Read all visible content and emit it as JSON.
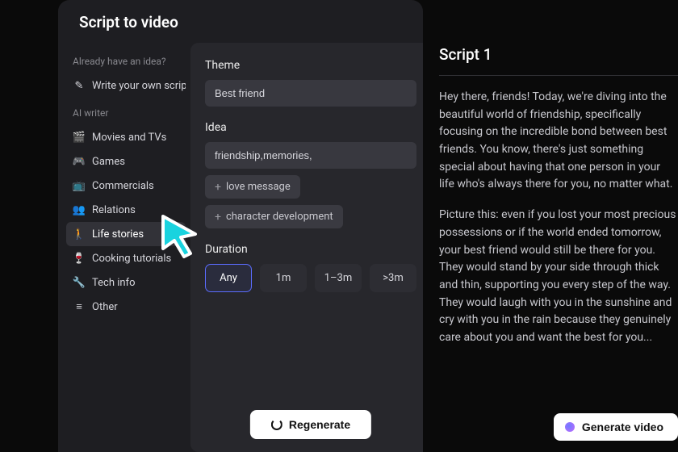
{
  "panelTitle": "Script to video",
  "sidebar": {
    "heading1": "Already have an idea?",
    "writeOwn": "Write your own script",
    "heading2": "AI writer",
    "items": [
      {
        "icon": "🎬",
        "label": "Movies and TVs"
      },
      {
        "icon": "🎮",
        "label": "Games"
      },
      {
        "icon": "📺",
        "label": "Commercials"
      },
      {
        "icon": "👥",
        "label": "Relations"
      },
      {
        "icon": "🚶",
        "label": "Life stories"
      },
      {
        "icon": "🍷",
        "label": "Cooking tutorials"
      },
      {
        "icon": "🔧",
        "label": "Tech info"
      },
      {
        "icon": "≡",
        "label": "Other"
      }
    ]
  },
  "form": {
    "themeLabel": "Theme",
    "themeValue": "Best friend",
    "ideaLabel": "Idea",
    "ideaValue": "friendship,memories,",
    "ideaChips": [
      "love message",
      "character development"
    ],
    "durationLabel": "Duration",
    "durations": [
      "Any",
      "1m",
      "1–3m",
      ">3m"
    ],
    "regenerate": "Regenerate"
  },
  "script": {
    "title": "Script 1",
    "para1": "Hey there, friends! Today, we're diving into the beautiful world of friendship, specifically focusing on the incredible bond between best friends. You know, there's just something special about having that one person in your life who's always there for you, no matter what.",
    "para2": "Picture this: even if you lost your most precious possessions or if the world ended tomorrow, your best friend would still be there for you. They would stand by your side through thick and thin, supporting you every step of the way. They would laugh with you in the sunshine and cry with you in the rain because they genuinely care about you and want the best for you...",
    "generate": "Generate video"
  }
}
